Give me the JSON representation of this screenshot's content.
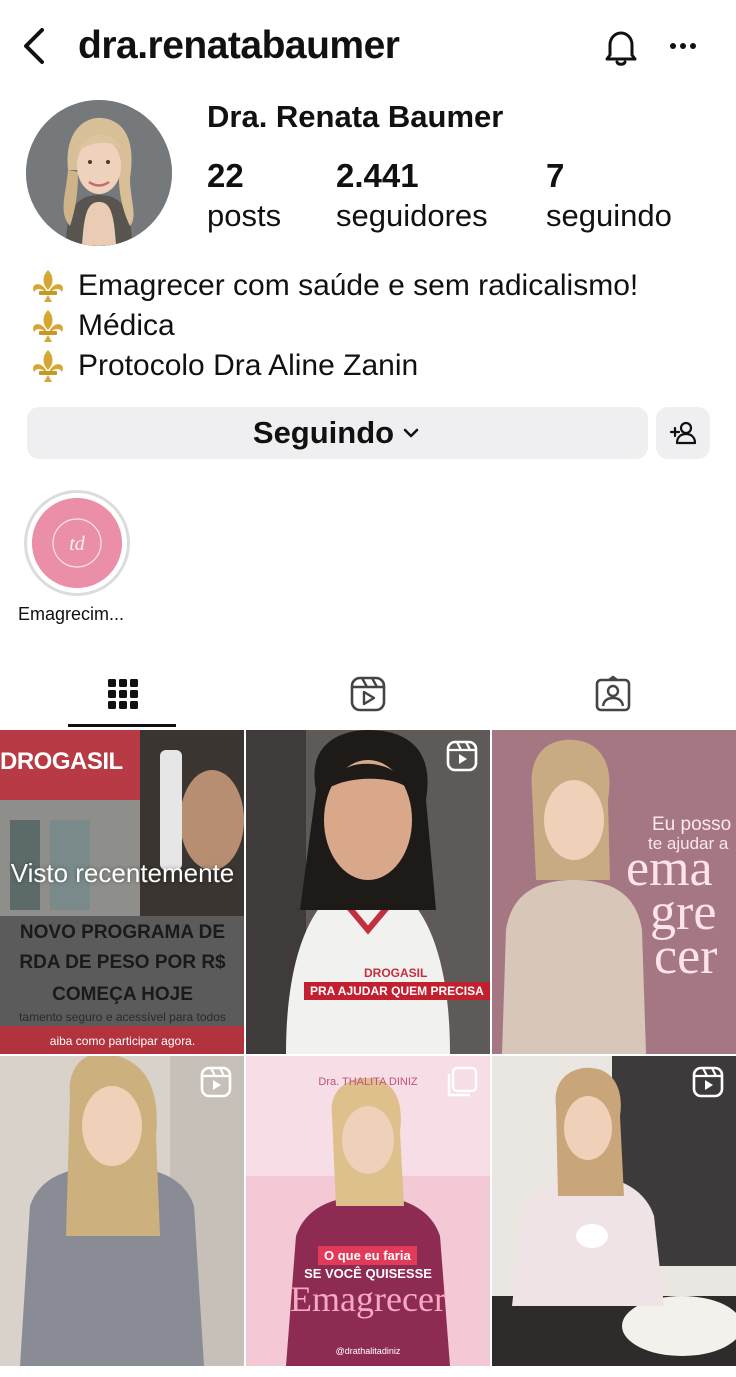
{
  "header": {
    "username": "dra.renatabaumer",
    "back_icon": "chevron-left-icon",
    "bell_icon": "bell-icon",
    "more_icon": "more-horizontal-icon"
  },
  "profile": {
    "full_name": "Dra. Renata Baumer",
    "stats": {
      "posts": {
        "value": "22",
        "label": "posts"
      },
      "followers": {
        "value": "2.441",
        "label": "seguidores"
      },
      "following": {
        "value": "7",
        "label": "seguindo"
      }
    },
    "bio": [
      {
        "icon": "fleur-de-lis-icon",
        "text": "Emagrecer com saúde e sem radicalismo!"
      },
      {
        "icon": "fleur-de-lis-icon",
        "text": "Médica"
      },
      {
        "icon": "fleur-de-lis-icon",
        "text": "Protocolo Dra Aline Zanin"
      }
    ]
  },
  "actions": {
    "follow_label": "Seguindo",
    "follow_chevron_icon": "chevron-down-icon",
    "add_user_icon": "add-user-icon"
  },
  "highlights": [
    {
      "label": "Emagrecim..."
    }
  ],
  "tabs": [
    {
      "name": "grid",
      "icon": "grid-icon",
      "active": true
    },
    {
      "name": "reels",
      "icon": "reels-icon",
      "active": false
    },
    {
      "name": "tagged",
      "icon": "tagged-user-icon",
      "active": false
    }
  ],
  "posts": [
    {
      "type": "image",
      "overlay": "Visto recentemente",
      "texts": {
        "brand": "DROGASIL",
        "line1": "NOVO PROGRAMA DE",
        "line2": "RDA DE PESO POR R$",
        "line3": "COMEÇA HOJE",
        "line4": "tamento seguro e acessível para todos",
        "line5": "aiba como participar agora."
      }
    },
    {
      "type": "reel",
      "texts": {
        "brand": "DROGASIL",
        "caption": "PRA AJUDAR QUEM PRECISA"
      }
    },
    {
      "type": "image",
      "texts": {
        "line1": "Eu posso",
        "line2": "te ajudar a",
        "big1": "ema",
        "big2": "gre",
        "big3": "cer"
      }
    },
    {
      "type": "reel",
      "texts": {}
    },
    {
      "type": "carousel",
      "texts": {
        "brand": "Dra. THALITA DINIZ",
        "label": "O que eu faria",
        "line": "SE VOCÊ QUISESSE",
        "big": "Emagrecer",
        "handle": "@drathalitadiniz"
      }
    },
    {
      "type": "reel",
      "texts": {}
    }
  ],
  "colors": {
    "button_bg": "#efeff1",
    "text": "#111111",
    "highlight_pink": "#ea8fa7",
    "drogasil_red": "#d9303e",
    "rose_background": "#a97d88"
  }
}
